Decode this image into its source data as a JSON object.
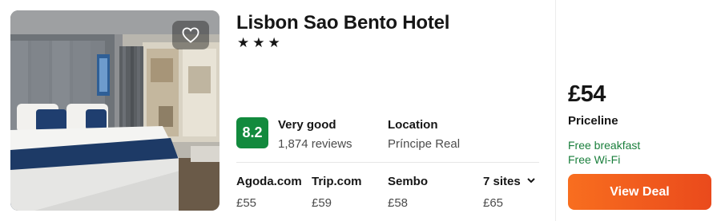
{
  "hotel": {
    "name": "Lisbon Sao Bento Hotel",
    "stars": "★★★",
    "favorite_icon": "heart-outline-icon"
  },
  "rating": {
    "score": "8.2",
    "label": "Very good",
    "reviews": "1,874 reviews"
  },
  "location": {
    "label": "Location",
    "value": "Príncipe Real"
  },
  "sites": [
    {
      "name": "Agoda.com",
      "price": "£55"
    },
    {
      "name": "Trip.com",
      "price": "£59"
    },
    {
      "name": "Sembo",
      "price": "£58"
    },
    {
      "name": "7 sites",
      "price": "£65",
      "icon": "chevron-down-icon"
    }
  ],
  "deal": {
    "price": "£54",
    "provider": "Priceline",
    "amenities": [
      "Free breakfast",
      "Free Wi-Fi"
    ],
    "button_label": "View Deal"
  },
  "colors": {
    "rating_badge": "#128a3d",
    "amenity_text": "#1a7f3c",
    "deal_button": "#f3621e"
  }
}
